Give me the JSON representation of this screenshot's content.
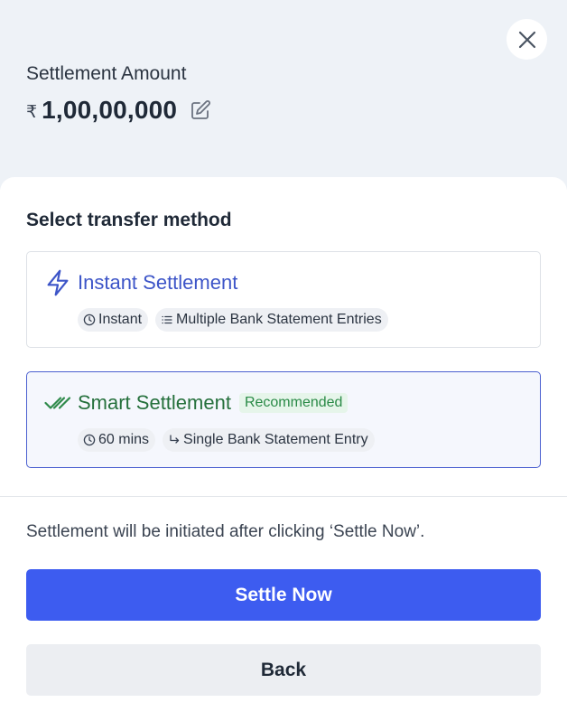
{
  "header": {
    "amount_label": "Settlement Amount",
    "currency_symbol": "₹",
    "amount_value": "1,00,00,000"
  },
  "transfer": {
    "section_title": "Select transfer method",
    "options": [
      {
        "title": "Instant Settlement",
        "icon": "lightning-icon",
        "badge": "",
        "selected": false,
        "chips": [
          {
            "icon": "clock-icon",
            "label": "Instant"
          },
          {
            "icon": "list-icon",
            "label": "Multiple Bank Statement Entries"
          }
        ]
      },
      {
        "title": "Smart Settlement",
        "icon": "double-check-icon",
        "badge": "Recommended",
        "selected": true,
        "chips": [
          {
            "icon": "clock-icon",
            "label": "60 mins"
          },
          {
            "icon": "return-arrow-icon",
            "label": "Single Bank Statement Entry"
          }
        ]
      }
    ]
  },
  "footer": {
    "note": "Settlement will be initiated after clicking ‘Settle Now’.",
    "primary_label": "Settle Now",
    "secondary_label": "Back"
  },
  "colors": {
    "primary": "#3d5cf0",
    "instant_accent": "#3d55c8",
    "smart_accent": "#25703c",
    "header_bg": "#eef2f7"
  }
}
